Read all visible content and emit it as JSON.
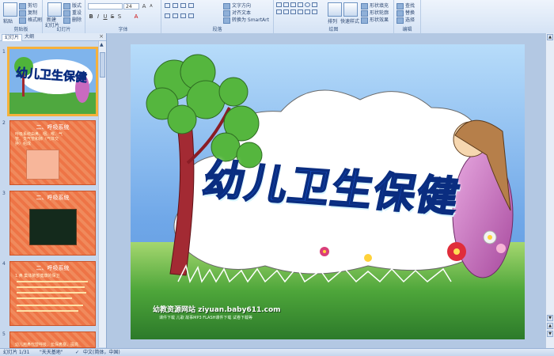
{
  "ribbon": {
    "clipboard": {
      "label": "剪贴板",
      "paste": "粘贴",
      "cut": "剪切",
      "copy": "复制",
      "format_painter": "格式刷"
    },
    "slides": {
      "label": "幻灯片",
      "new_slide": "新建",
      "new_slide2": "幻灯片",
      "layout": "版式",
      "reset": "重设",
      "delete": "删除"
    },
    "font": {
      "label": "字体",
      "font_name": "",
      "font_size": "24"
    },
    "paragraph": {
      "label": "段落",
      "text_direction": "文字方向",
      "align_text": "对齐文本",
      "smartart": "转换为 SmartArt"
    },
    "drawing": {
      "label": "绘图",
      "arrange": "排列",
      "quick_styles": "快速样式",
      "shape_fill": "形状填充",
      "shape_outline": "形状轮廓",
      "shape_effects": "形状效果"
    },
    "editing": {
      "label": "编辑",
      "find": "查找",
      "replace": "替换",
      "select": "选择"
    }
  },
  "leftpane": {
    "tab_slides": "幻灯片",
    "tab_outline": "大纲",
    "close": "×",
    "thumbs": [
      {
        "num": "1",
        "title": "幼儿卫生保健"
      },
      {
        "num": "2",
        "title": "二、呼吸系统",
        "text": "呼吸系统由鼻、咽、喉、气管、支气管和肺（气体交换）组成"
      },
      {
        "num": "3",
        "title": "二、呼吸系统"
      },
      {
        "num": "4",
        "title": "二、呼吸系统",
        "text": "1.鼻 集体肺部健康的保卫"
      },
      {
        "num": "5",
        "text": "幼儿用鼻代替呼吸，长保鼻塞，提高"
      }
    ]
  },
  "slide": {
    "title": "幼儿卫生保健",
    "credit1": "幼教资源网站 ziyuan.baby611.com",
    "credit2": "课件下载  儿歌  故事MP3  FLASH课件下载  试卷下载等"
  },
  "statusbar": {
    "slide_info": "幻灯片 1/31",
    "theme": "\"天天基地\"",
    "language": "中文(简体，中国)"
  },
  "colors": {
    "ribbon": "#d5e3f5",
    "thumb_orange": "#ee7446",
    "slide_sky": "#7fb4ec",
    "grass": "#3e9a35",
    "title_blue": "#1b5fe3"
  }
}
